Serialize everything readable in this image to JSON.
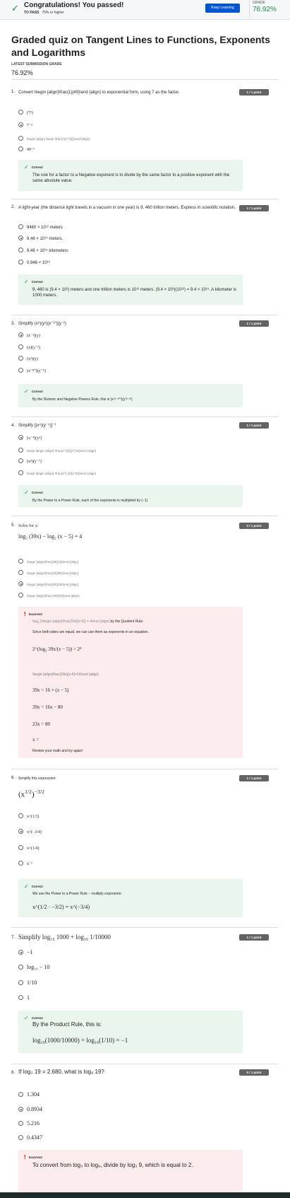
{
  "banner": {
    "title": "Congratulations! You passed!",
    "to_pass_label": "TO PASS",
    "to_pass_value": "75% or higher",
    "keep_learning": "Keep Learning",
    "grade_label": "GRADE",
    "grade_value": "76.92%"
  },
  "quiz": {
    "title": "Graded quiz on Tangent Lines to Functions, Exponents and Logarithms",
    "latest_label": "LATEST SUBMISSION GRADE",
    "latest_value": "76.92%"
  },
  "q1": {
    "num": "1.",
    "text": "Convert \\begin {align}\\frac{1}{49}\\end {align} to exponential form, using 7 as the factor.",
    "points": "1 / 1 point",
    "options": [
      "(7²)",
      "7⁻²",
      "\\begin {align} \\large \\frac{7}{7^{5}}\\end {align}",
      "49⁻¹"
    ],
    "fb_label": "Correct",
    "fb_text": "The rule for a factor to a Negative exponent is to divide by the same factor to a positive exponent with the same absolute value."
  },
  "q2": {
    "num": "2.",
    "text": "A light-year (the distance light travels in a vacuum in one year) is 9, 460 trillion meters. Express in scientific notation.",
    "points": "1 / 1 point",
    "options": [
      "9460 × 10¹² meters",
      "9.46 × 10¹⁵ meters.",
      "9.46 × 10¹⁵ kilometers",
      "0.946 × 10¹⁶"
    ],
    "fb_label": "Correct",
    "fb_text": "9, 460 is (9.4 × 10³) meters and one trillion meters is 10¹² meters. (9.4 × 10³)(10¹²) = 9.4 × 10¹⁵. A kilometer is 1000 meters."
  },
  "q3": {
    "num": "3.",
    "text": "Simplify (x⁸)(y³)(x⁻¹⁰)(y⁻²)",
    "points": "1 / 1 point",
    "options": [
      "(x⁻²)(y)",
      "(x)(y⁻²)",
      "(x²)(y)",
      "(x⁻⁸⁰)(y⁻⁶)"
    ],
    "fb_label": "Correct",
    "fb_text": "By the Division and Negative Powers Rule, this is (x⁽⁸⁻¹⁰⁾)(y⁽³⁻²⁾)"
  },
  "q4": {
    "num": "4.",
    "text": "Simplify [(x⁴)(y⁻⁵)]⁻¹",
    "points": "1 / 1 point",
    "options": [
      "(x⁻⁴)(y⁵)",
      "\\large \\begin {align} \\frac{x^{4}}{y^{-5}}\\end {align}",
      "(x³)(y⁻⁷)",
      "\\large \\begin {align} \\frac{x^{-4}}{y^{5}}\\end {align}"
    ],
    "fb_label": "Correct",
    "fb_text": "By the Power to a Power Rule, each of the exponents is multiplied by (−1)"
  },
  "q5": {
    "num": "5.",
    "text": "Solve for x:",
    "equation": "log₂ (39x) − log₂ (x − 5) = 4",
    "points": "0 / 1 point",
    "options": [
      "\\begin {align}\\frac{39}{23}\\end {align}",
      "\\begin {align}\\frac{23}{80}\\end {align}",
      "\\begin {align}\\frac{80}{39}\\end {align}",
      "\\begin {align}\\frac{-80}{23}\\end {align}"
    ],
    "fb_label": "Incorrect",
    "fb_line1a": "\\log_2\\begin {align}\\frac{39x}{x-5}} = 4\\end {align}",
    "fb_line1b": " by the Quotient Rule.",
    "fb_line2": "Since both sides are equal, we can use them as exponents in an equation.",
    "fb_eq1": "2^(log₂ 39x/(x − 5)) = 2⁴",
    "fb_line3": "\\begin {align}\\frac{39x}{x-5}=16\\end {align}",
    "fb_eq2": "39x = 16 × (x − 5)",
    "fb_eq3": "39x = 16x − 80",
    "fb_eq4": "23x = 80",
    "fb_eq5": "x =",
    "fb_line4": "Review your math and try again!"
  },
  "q6": {
    "num": "6.",
    "text": "Simplify this expression:",
    "expr_base": "(x",
    "expr_inner": "1/2",
    "expr_outer": "−3/2",
    "points": "1 / 1 point",
    "options": [
      "x^(1/3)",
      "x^(−3/4)",
      "x^(1/4)",
      "x⁻¹"
    ],
    "fb_label": "Correct",
    "fb_text": "We use the Power to a Power Rule -- multiply exponents:",
    "fb_eq": "x^(1/2 · −3/2) = x^(−3/4)"
  },
  "q7": {
    "num": "7.",
    "text": "Simplify log₁₀ 1000 + log₁₀ 1/10000",
    "points": "1 / 1 point",
    "options": [
      "−1",
      "log₁₀ − 10",
      "1/10",
      "1"
    ],
    "fb_label": "Correct",
    "fb_text": "By the Product Rule, this is:",
    "fb_eq": "log₁₀(1000/10000) = log₁₀(1/10) = −1"
  },
  "q8": {
    "num": "8.",
    "text": "If log₃ 19 = 2.680, what is log₉ 19?",
    "points": "0 / 1 point",
    "options": [
      "1.304",
      "0.8934",
      "5.216",
      "0.4347"
    ],
    "fb_label": "Incorrect",
    "fb_text": "To convert from log₃ to log₉, divide by log₃ 9, which is equal to 2."
  }
}
